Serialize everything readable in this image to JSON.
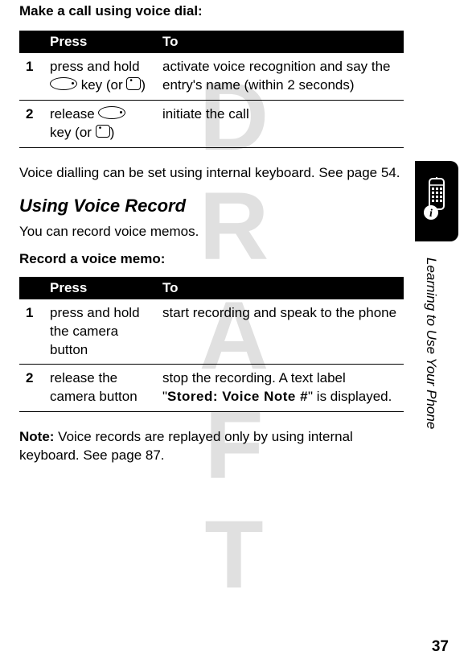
{
  "watermark": "DRAFT",
  "intro": "Make a call using voice dial:",
  "table1": {
    "headers": {
      "press": "Press",
      "to": "To"
    },
    "rows": [
      {
        "num": "1",
        "press_a": "press and hold ",
        "press_b": " key (or ",
        "press_c": ")",
        "to": "activate voice recognition and say the entry's name (within 2 seconds)"
      },
      {
        "num": "2",
        "press_a": " release ",
        "press_b": " key (or ",
        "press_c": ")",
        "to": "initiate the call"
      }
    ]
  },
  "after_table1": "Voice dialling can be set using internal keyboard. See page 54.",
  "section_heading": "Using Voice Record",
  "section_body": "You can record voice memos.",
  "record_intro": "Record a voice memo:",
  "table2": {
    "headers": {
      "press": "Press",
      "to": "To"
    },
    "rows": [
      {
        "num": "1",
        "press": "press and hold the camera button",
        "to": "start recording and speak to the phone"
      },
      {
        "num": "2",
        "press": "release the camera button",
        "to_a": "stop the recording. A text label \"",
        "to_label": "Stored: Voice Note #",
        "to_b": "\" is displayed."
      }
    ]
  },
  "note_label": "Note:",
  "note_text": " Voice records are replayed only by using internal keyboard. See page 87.",
  "side_caption": "Learning to Use Your Phone",
  "page_number": "37"
}
